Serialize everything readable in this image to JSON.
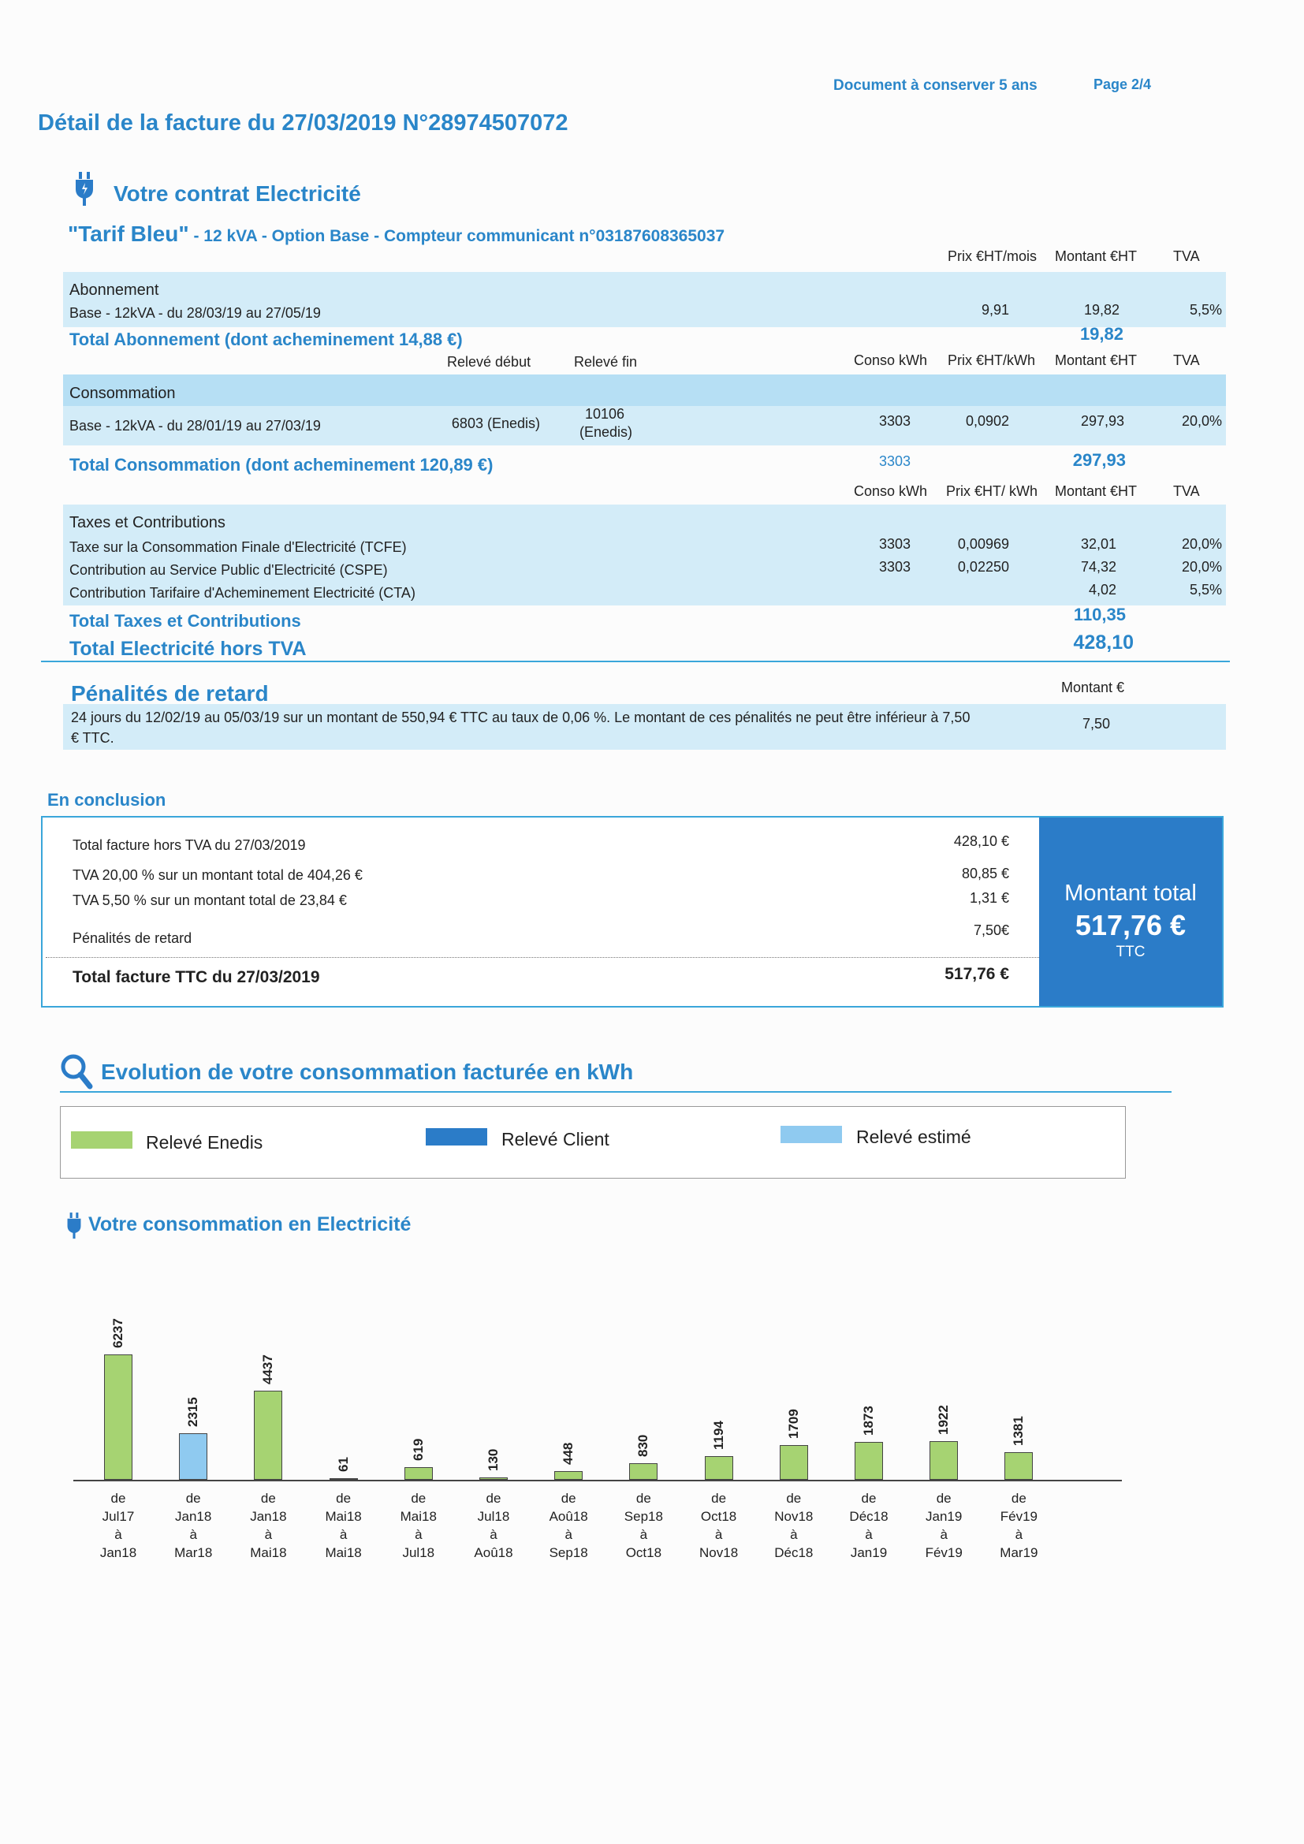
{
  "header": {
    "doc_keep": "Document à conserver 5 ans",
    "page": "Page 2/4",
    "title": "Détail de la facture du 27/03/2019 N°28974507072"
  },
  "contract": {
    "heading": "Votre contrat Electricité",
    "tarif_name": "\"Tarif Bleu\"",
    "tarif_details": " - 12 kVA - Option Base - Compteur communicant n°03187608365037"
  },
  "abonnement": {
    "col_headers": [
      "Prix €HT/mois",
      "Montant €HT",
      "TVA"
    ],
    "section": "Abonnement",
    "line_label": "Base - 12kVA - du 28/03/19 au 27/05/19",
    "prix": "9,91",
    "montant": "19,82",
    "tva": "5,5%",
    "total_label": "Total Abonnement (dont acheminement 14,88 €)",
    "total_value": "19,82"
  },
  "consommation": {
    "col_headers": [
      "Relevé début",
      "Relevé fin",
      "Conso kWh",
      "Prix €HT/kWh",
      "Montant €HT",
      "TVA"
    ],
    "section": "Consommation",
    "line_label": "Base - 12kVA - du 28/01/19 au 27/03/19",
    "releve_debut": "6803 (Enedis)",
    "releve_fin_1": "10106",
    "releve_fin_2": "(Enedis)",
    "conso": "3303",
    "prix": "0,0902",
    "montant": "297,93",
    "tva": "20,0%",
    "total_label": "Total Consommation (dont acheminement 120,89 €)",
    "total_conso": "3303",
    "total_value": "297,93"
  },
  "taxes": {
    "col_headers": [
      "Conso kWh",
      "Prix €HT/ kWh",
      "Montant €HT",
      "TVA"
    ],
    "section": "Taxes et Contributions",
    "rows": [
      {
        "label": "Taxe sur la Consommation Finale d'Electricité (TCFE)",
        "conso": "3303",
        "prix": "0,00969",
        "montant": "32,01",
        "tva": "20,0%"
      },
      {
        "label": "Contribution au Service Public d'Electricité (CSPE)",
        "conso": "3303",
        "prix": "0,02250",
        "montant": "74,32",
        "tva": "20,0%"
      },
      {
        "label": "Contribution Tarifaire d'Acheminement Electricité (CTA)",
        "conso": "",
        "prix": "",
        "montant": "4,02",
        "tva": "5,5%"
      }
    ],
    "total_label": "Total Taxes et Contributions",
    "total_value": "110,35",
    "total_elec_label": "Total Electricité hors TVA",
    "total_elec_value": "428,10"
  },
  "penalites": {
    "heading": "Pénalités de retard",
    "col_header": "Montant €",
    "text_1": "24 jours du 12/02/19 au 05/03/19 sur un montant de 550,94 € TTC au taux de 0,06 %. Le montant de ces pénalités ne peut être inférieur à 7,50",
    "text_2": "€ TTC.",
    "value": "7,50"
  },
  "conclusion": {
    "heading": "En conclusion",
    "rows": [
      {
        "label": "Total facture hors TVA du 27/03/2019",
        "value": "428,10 €"
      },
      {
        "label": "TVA 20,00 % sur un montant total de 404,26 €",
        "value": "80,85 €"
      },
      {
        "label": "TVA 5,50 % sur un montant total de 23,84 €",
        "value": "1,31 €"
      },
      {
        "label": "Pénalités de retard",
        "value": "7,50€"
      }
    ],
    "total_label": "Total facture TTC du 27/03/2019",
    "total_value": "517,76 €",
    "box_title": "Montant total",
    "box_amount": "517,76 €",
    "box_ttc": "TTC"
  },
  "evolution": {
    "heading": "Evolution de votre consommation facturée en kWh",
    "legend": [
      {
        "label": "Relevé Enedis",
        "color": "#a6d372"
      },
      {
        "label": "Relevé Client",
        "color": "#2b7cc8"
      },
      {
        "label": "Relevé estimé",
        "color": "#8fcaf0"
      }
    ],
    "sub_heading": "Votre consommation en Electricité"
  },
  "chart_data": {
    "type": "bar",
    "unit": "kWh",
    "categories": [
      [
        "de",
        "Jul17",
        "à",
        "Jan18"
      ],
      [
        "de",
        "Jan18",
        "à",
        "Mar18"
      ],
      [
        "de",
        "Jan18",
        "à",
        "Mai18"
      ],
      [
        "de",
        "Mai18",
        "à",
        "Mai18"
      ],
      [
        "de",
        "Mai18",
        "à",
        "Jul18"
      ],
      [
        "de",
        "Jul18",
        "à",
        "Aoû18"
      ],
      [
        "de",
        "Aoû18",
        "à",
        "Sep18"
      ],
      [
        "de",
        "Sep18",
        "à",
        "Oct18"
      ],
      [
        "de",
        "Oct18",
        "à",
        "Nov18"
      ],
      [
        "de",
        "Nov18",
        "à",
        "Déc18"
      ],
      [
        "de",
        "Déc18",
        "à",
        "Jan19"
      ],
      [
        "de",
        "Jan19",
        "à",
        "Fév19"
      ],
      [
        "de",
        "Fév19",
        "à",
        "Mar19"
      ]
    ],
    "values": [
      6237,
      2315,
      4437,
      61,
      619,
      130,
      448,
      830,
      1194,
      1709,
      1873,
      1922,
      1381
    ],
    "types": [
      "Relevé Enedis",
      "Relevé estimé",
      "Relevé Enedis",
      "Relevé Enedis",
      "Relevé Enedis",
      "Relevé Enedis",
      "Relevé Enedis",
      "Relevé Enedis",
      "Relevé Enedis",
      "Relevé Enedis",
      "Relevé Enedis",
      "Relevé Enedis",
      "Relevé Enedis"
    ],
    "ylim": [
      0,
      6237
    ]
  }
}
